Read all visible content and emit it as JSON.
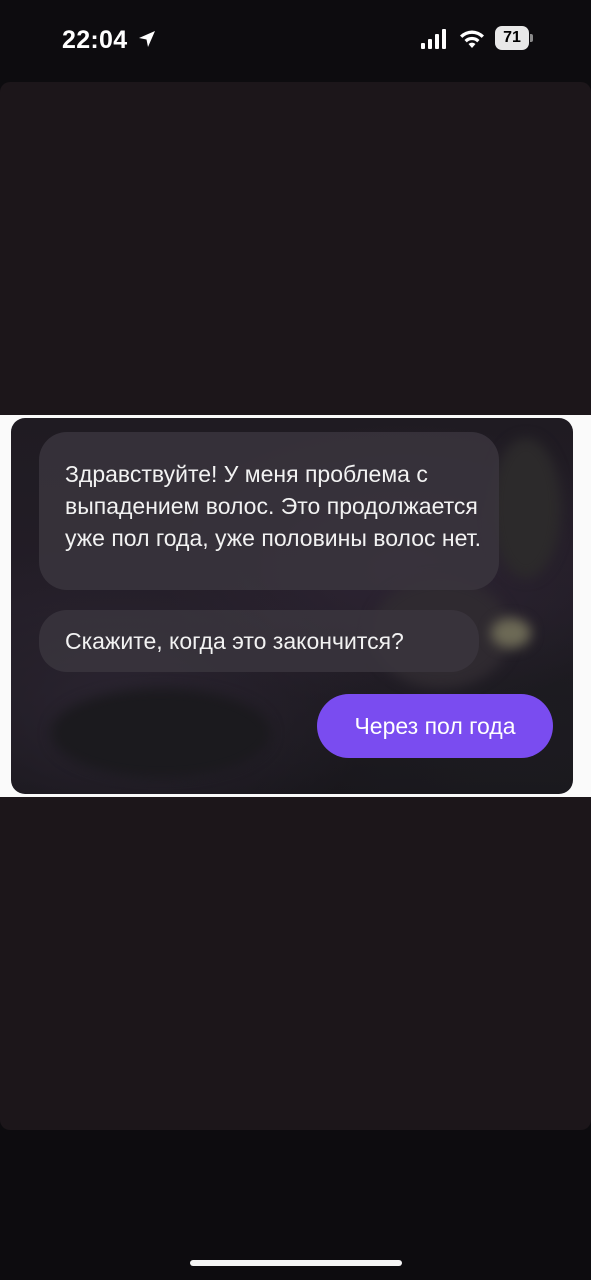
{
  "status_bar": {
    "time": "22:04",
    "battery_level": "71",
    "icons": [
      "location-arrow-icon",
      "cellular-signal-icon",
      "wifi-icon",
      "battery-icon"
    ]
  },
  "image": {
    "messages": [
      {
        "direction": "incoming",
        "text": "Здравствуйте! У меня проблема с выпадением волос. Это продолжается уже пол года, уже половины волос нет."
      },
      {
        "direction": "incoming",
        "text": "Скажите, когда это закончится?"
      },
      {
        "direction": "outgoing",
        "text": "Через пол года"
      }
    ]
  },
  "colors": {
    "outgoing_bubble": "#7a4cf0",
    "incoming_bubble": "#3a363e",
    "viewer_background": "#1c161a",
    "screen_background": "#0d0c0f"
  }
}
